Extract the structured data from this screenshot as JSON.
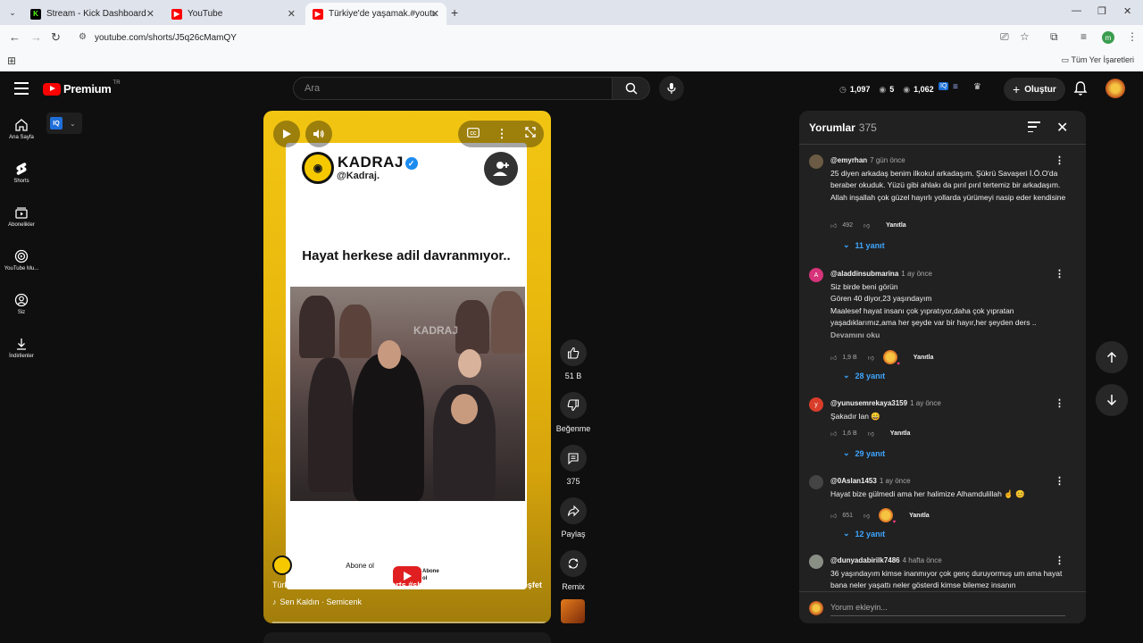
{
  "browser": {
    "tabs": [
      {
        "title": "Stream - Kick Dashboard",
        "favicon": "kick-icon",
        "color": "#53fc18"
      },
      {
        "title": "YouTube",
        "favicon": "youtube-icon",
        "color": "#ff0000"
      },
      {
        "title": "Türkiye'de yaşamak.#youtubesh",
        "favicon": "youtube-icon",
        "color": "#ff0000"
      }
    ],
    "url": "youtube.com/shorts/J5q26cMamQY",
    "bookmarks_all": "Tüm Yer İşaretleri",
    "profile_letter": "m"
  },
  "header": {
    "logo_word": "Premium",
    "logo_region": "TR",
    "search_placeholder": "Ara",
    "stats": {
      "views": "1,097",
      "likes": "5",
      "watch": "1,062"
    },
    "create_label": "Oluştur"
  },
  "guide": {
    "items": [
      {
        "label": "Ana Sayfa",
        "icon": "home-icon"
      },
      {
        "label": "Shorts",
        "icon": "shorts-icon"
      },
      {
        "label": "Abonelikler",
        "icon": "subscriptions-icon"
      },
      {
        "label": "YouTube Mu...",
        "icon": "youtube-music-icon"
      },
      {
        "label": "Siz",
        "icon": "you-icon"
      },
      {
        "label": "İndirilenler",
        "icon": "downloads-icon"
      }
    ],
    "chip_label": "IQ"
  },
  "short": {
    "brand_name": "KADRAJ",
    "brand_handle": "@Kadraj.",
    "headline": "Hayat herkese adil davranmıyor..",
    "watermark": "KADRAJ",
    "channel_handle": "@Kadraj.",
    "subscribe_label": "Abone ol",
    "sub_logo_text": "Abone ol",
    "title_plain": "Türkiye'de yaşamak.",
    "title_tags": "#youtubeshorts #shortvideo #komedi #viral #keşfet",
    "music": "Sen Kaldın · Semicenk"
  },
  "actions": {
    "likes": "51 B",
    "dislike_label": "Beğenme",
    "comments": "375",
    "share_label": "Paylaş",
    "remix_label": "Remix"
  },
  "comments": {
    "title": "Yorumlar",
    "count": "375",
    "items": [
      {
        "author": "@emyrhan",
        "time": "7 gün önce",
        "text": "25 diyen arkadaş benim ilkokul arkadaşım. Şükrü Savaşeri İ.Ö.O'da beraber okuduk. Yüzü gibi ahlakı da pırıl pırıl tertemiz bir arkadaşım. Allah inşallah çok güzel hayırlı yollarda yürümeyi nasip eder kendisine",
        "likes": "492",
        "reply_label": "Yanıtla",
        "replies": "11 yanıt",
        "avatar_color": "#6b5a44",
        "avatar_letter": ""
      },
      {
        "author": "@aladdinsubmarina",
        "time": "1 ay önce",
        "line1": "Siz birde beni görün",
        "line2": "Gören 40 diyor,23 yaşındayım",
        "line3": "Maalesef hayat insanı çok yıpratıyor,daha çok yıpratan yaşadıklarımız,ama her şeyde var bir hayır,her şeyden ders ..",
        "read_more": "Devamını oku",
        "likes": "1,9 B",
        "reply_label": "Yanıtla",
        "replies": "28 yanıt",
        "avatar_color": "#d6337a",
        "avatar_letter": "A"
      },
      {
        "author": "@yunusemrekaya3159",
        "time": "1 ay önce",
        "text": "Şakadır lan 😄",
        "likes": "1,6 B",
        "reply_label": "Yanıtla",
        "replies": "29 yanıt",
        "avatar_color": "#d93d2b",
        "avatar_letter": "y"
      },
      {
        "author": "@0Aslan1453",
        "time": "1 ay önce",
        "text": "Hayat bize gülmedi ama her halimize Alhamdulillah ☝️ 😊",
        "likes": "651",
        "reply_label": "Yanıtla",
        "replies": "12 yanıt",
        "avatar_color": "#444444",
        "avatar_letter": ""
      },
      {
        "author": "@dunyadabirilk7486",
        "time": "4 hafta önce",
        "text": "36 yaşındayım kimse inanmıyor çok genç duruyormuş um ama hayat bana neler yaşattı neler gösterdi kimse bilemez  insanın",
        "avatar_color": "#8a8f86",
        "avatar_letter": ""
      }
    ],
    "add_placeholder": "Yorum ekleyin..."
  }
}
